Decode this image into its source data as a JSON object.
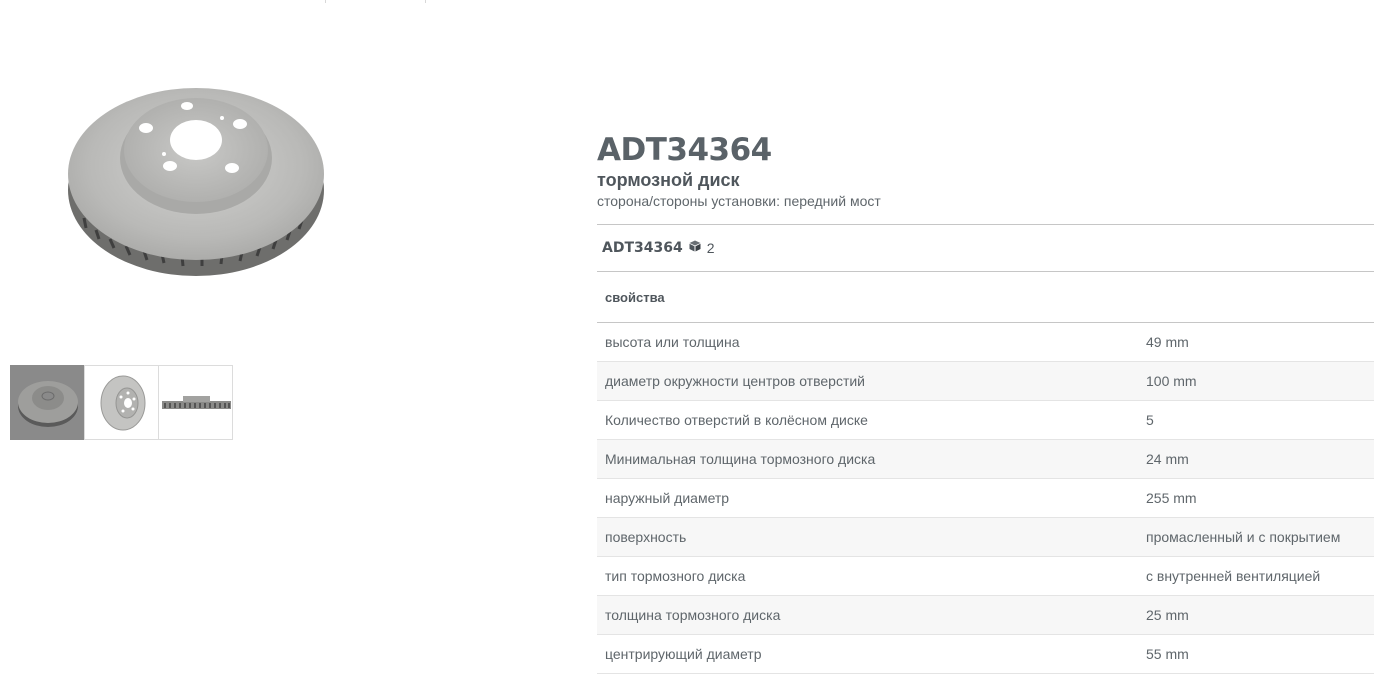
{
  "product": {
    "part_number": "ADT34364",
    "name": "тормозной диск",
    "install_side": "сторона/стороны установки: передний мост"
  },
  "variant": {
    "code": "ADT34364",
    "icon": "box-icon",
    "quantity": "2"
  },
  "properties": {
    "header": "свойства",
    "rows": [
      {
        "name": "высота или толщина",
        "value": "49 mm"
      },
      {
        "name": "диаметр окружности центров отверстий",
        "value": "100 mm"
      },
      {
        "name": "Количество отверстий в колёсном диске",
        "value": "5"
      },
      {
        "name": "Минимальная толщина тормозного диска",
        "value": "24 mm"
      },
      {
        "name": "наружный диаметр",
        "value": "255 mm"
      },
      {
        "name": "поверхность",
        "value": "промасленный и с покрытием"
      },
      {
        "name": "тип тормозного диска",
        "value": "с внутренней вентиляцией"
      },
      {
        "name": "толщина тормозного диска",
        "value": "25 mm"
      },
      {
        "name": "центрирующий диаметр",
        "value": "55 mm"
      }
    ]
  },
  "gallery": {
    "thumbnails": [
      "brake-disc-angled",
      "brake-disc-front",
      "brake-disc-side"
    ],
    "active_index": 0
  }
}
